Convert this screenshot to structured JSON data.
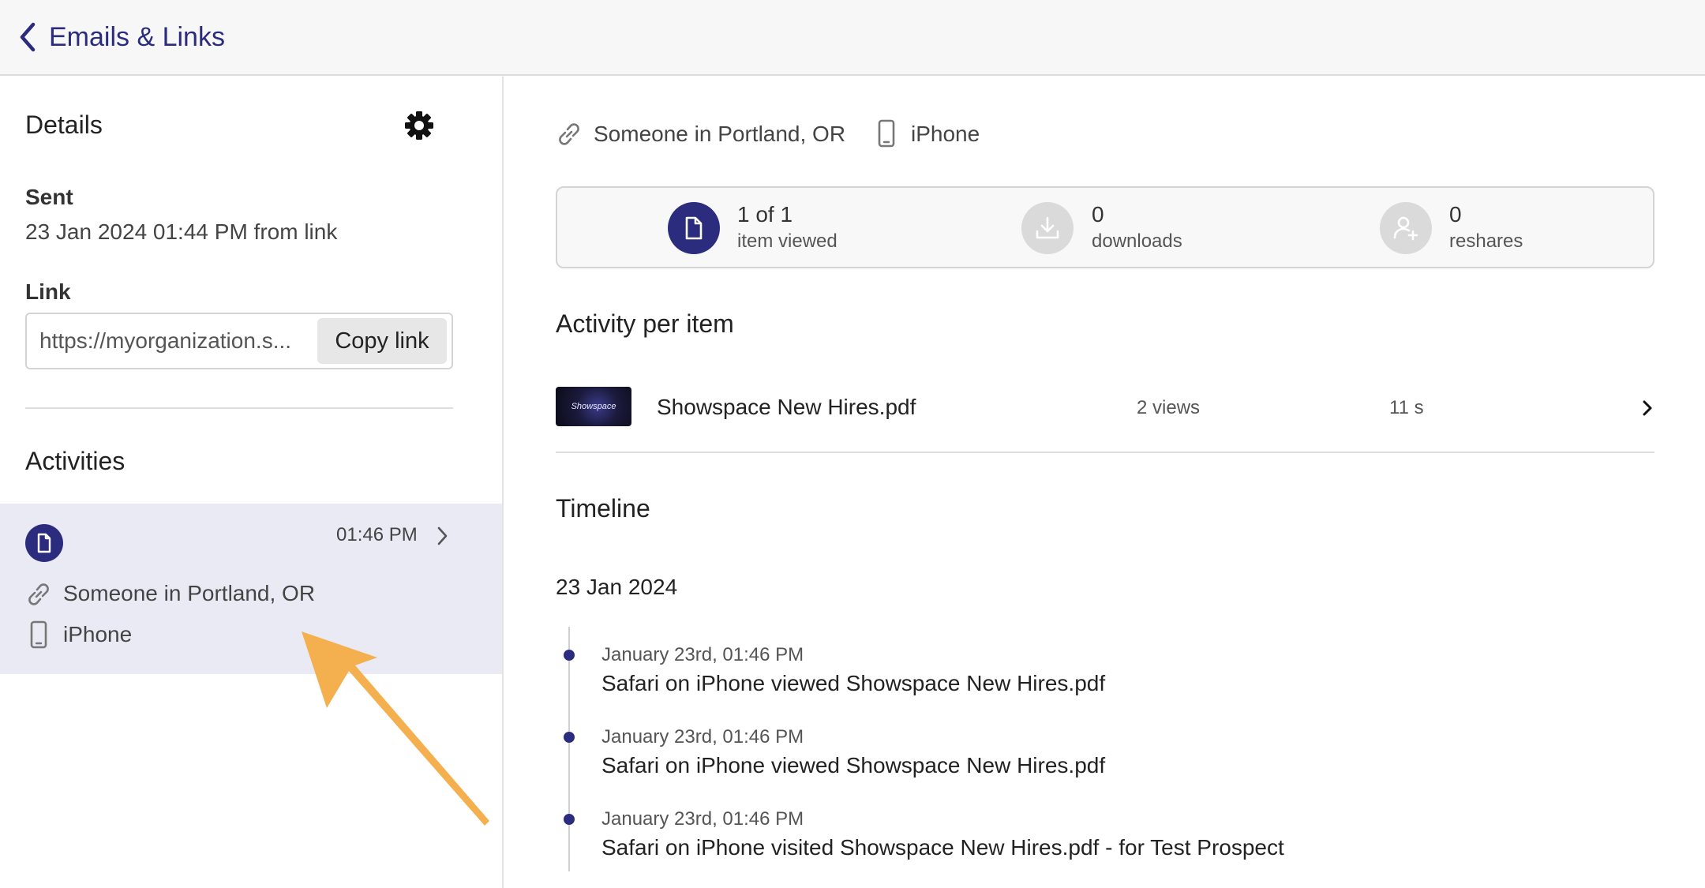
{
  "nav": {
    "back_label": "Emails & Links"
  },
  "details": {
    "heading": "Details",
    "sent_label": "Sent",
    "sent_value": "23 Jan 2024 01:44 PM from link",
    "link_label": "Link",
    "link_value": "https://myorganization.s...",
    "copy_button": "Copy link"
  },
  "activities": {
    "heading": "Activities",
    "items": [
      {
        "time": "01:46 PM",
        "location": "Someone in Portland, OR",
        "device": "iPhone"
      }
    ]
  },
  "summary": {
    "location": "Someone in Portland, OR",
    "device": "iPhone",
    "stats": [
      {
        "value": "1 of 1",
        "label": "item viewed",
        "icon": "document-icon"
      },
      {
        "value": "0",
        "label": "downloads",
        "icon": "download-icon"
      },
      {
        "value": "0",
        "label": "reshares",
        "icon": "add-person-icon"
      }
    ]
  },
  "activity_per_item": {
    "heading": "Activity per item",
    "items": [
      {
        "thumbnail_text": "Showspace",
        "name": "Showspace New Hires.pdf",
        "views": "2 views",
        "duration": "11 s"
      }
    ]
  },
  "timeline": {
    "heading": "Timeline",
    "date": "23 Jan 2024",
    "events": [
      {
        "time": "January 23rd, 01:46 PM",
        "text": "Safari on iPhone viewed Showspace New Hires.pdf"
      },
      {
        "time": "January 23rd, 01:46 PM",
        "text": "Safari on iPhone viewed Showspace New Hires.pdf"
      },
      {
        "time": "January 23rd, 01:46 PM",
        "text": "Safari on iPhone visited Showspace New Hires.pdf - for Test Prospect"
      }
    ]
  },
  "colors": {
    "accent": "#2c2c7e",
    "selected_bg": "#e9eaf3",
    "annotation_arrow": "#f4b04e"
  }
}
